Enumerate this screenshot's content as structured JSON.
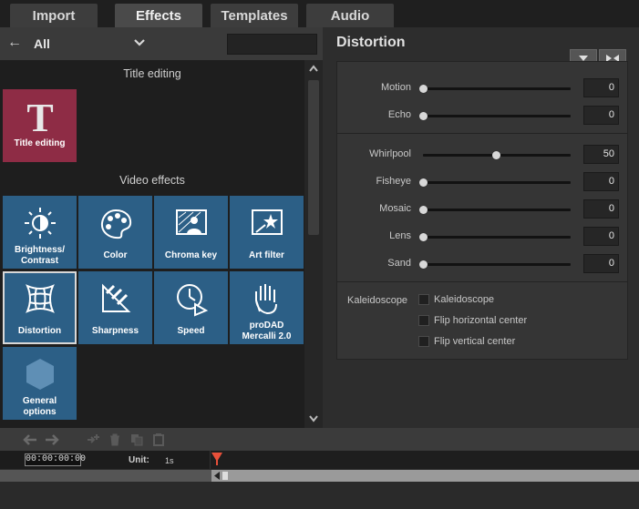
{
  "tabs": [
    {
      "label": "Import",
      "active": false
    },
    {
      "label": "Effects",
      "active": true
    },
    {
      "label": "Templates",
      "active": false
    },
    {
      "label": "Audio",
      "active": false
    }
  ],
  "left_panel": {
    "category": "All",
    "search_value": "",
    "sections": [
      {
        "title": "Title editing"
      },
      {
        "title": "Video effects"
      }
    ],
    "tiles": [
      {
        "label": "Title editing",
        "icon": "title-t-icon",
        "color": "#8e2c45"
      },
      {
        "label": "Brightness/ Contrast",
        "icon": "brightness-sun-icon",
        "color": "#2c5f86"
      },
      {
        "label": "Color",
        "icon": "color-palette-icon",
        "color": "#2c5f86"
      },
      {
        "label": "Chroma key",
        "icon": "chroma-key-icon",
        "color": "#2c5f86"
      },
      {
        "label": "Art filter",
        "icon": "art-filter-icon",
        "color": "#2c5f86"
      },
      {
        "label": "Distortion",
        "icon": "distortion-grid-icon",
        "color": "#2c5f86",
        "selected": true
      },
      {
        "label": "Sharpness",
        "icon": "sharpness-icon",
        "color": "#2c5f86"
      },
      {
        "label": "Speed",
        "icon": "speed-clock-icon",
        "color": "#2c5f86"
      },
      {
        "label": "proDAD Mercalli 2.0",
        "icon": "mercalli-hand-icon",
        "color": "#2c5f86"
      },
      {
        "label": "General options",
        "icon": "general-hexagon-icon",
        "color": "#2c5f86"
      }
    ]
  },
  "right_panel": {
    "title": "Distortion",
    "params": [
      {
        "label": "Motion",
        "value": "0",
        "level": 0
      },
      {
        "label": "Echo",
        "value": "0",
        "level": 0
      },
      {
        "label": "Whirlpool",
        "value": "50",
        "level": 0.5
      },
      {
        "label": "Fisheye",
        "value": "0",
        "level": 0
      },
      {
        "label": "Mosaic",
        "value": "0",
        "level": 0
      },
      {
        "label": "Lens",
        "value": "0",
        "level": 0
      },
      {
        "label": "Sand",
        "value": "0",
        "level": 0
      }
    ],
    "kaleidoscope": {
      "label": "Kaleidoscope",
      "options": [
        {
          "label": "Kaleidoscope",
          "checked": false
        },
        {
          "label": "Flip horizontal center",
          "checked": false
        },
        {
          "label": "Flip vertical center",
          "checked": false
        }
      ]
    }
  },
  "timeline": {
    "timecode": "00:00:00:00",
    "unit_label": "Unit:",
    "unit_value": "1s"
  },
  "colors": {
    "tile_blue": "#2c5f86",
    "tile_red": "#8e2c45",
    "playhead": "#e8503a"
  }
}
